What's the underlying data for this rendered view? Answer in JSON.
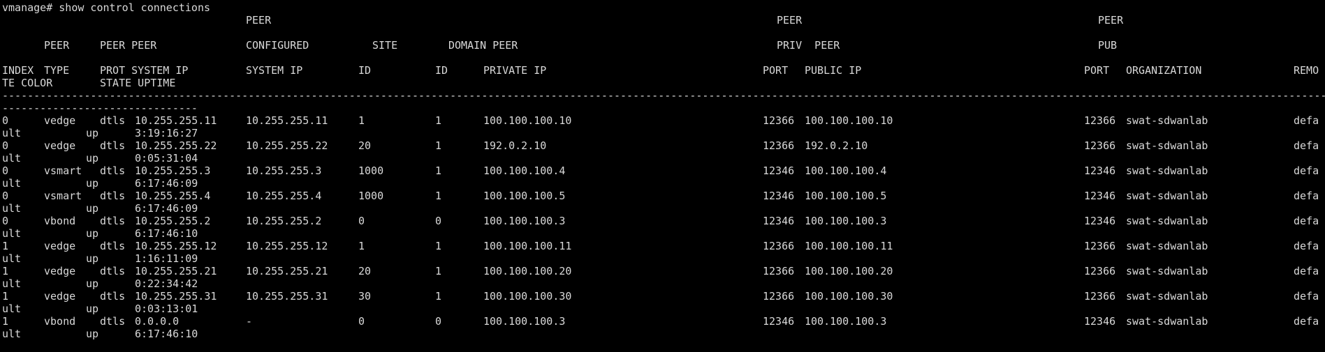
{
  "prompt": "vmanage# show control connections",
  "header": {
    "row1": {
      "peer_a": "PEER",
      "peer_b": "PEER",
      "peer_c": "PEER"
    },
    "row2": {
      "peer": "PEER",
      "peer_peer": "PEER PEER",
      "configured": "CONFIGURED",
      "site": "SITE",
      "domain_peer": "DOMAIN PEER",
      "priv_peer": "PRIV  PEER",
      "pub": "PUB"
    },
    "row3": {
      "index": "INDEX",
      "type": "TYPE",
      "prot_system_ip": "PROT SYSTEM IP",
      "system_ip": "SYSTEM IP",
      "id_site": "ID",
      "id_domain": "ID",
      "private_ip": "PRIVATE IP",
      "port_priv": "PORT",
      "public_ip": "PUBLIC IP",
      "port_pub": "PORT",
      "organization": "ORGANIZATION",
      "remo": "REMO"
    },
    "row4": {
      "te_color": "TE COLOR",
      "state_uptime": "STATE UPTIME"
    }
  },
  "separator_line1": "-----------------------------------------------------------------------------------------------------------------------------------------------------------------------------------------------------------------------------",
  "separator_line2": "-------------------------------",
  "rows": [
    {
      "index": "0",
      "type": "vedge",
      "prot": "dtls",
      "peer_system_ip": "10.255.255.11",
      "configured_system_ip": "10.255.255.11",
      "site_id": "1",
      "domain_id": "1",
      "private_ip": "100.100.100.10",
      "priv_port": "12366",
      "public_ip": "100.100.100.10",
      "pub_port": "12366",
      "organization": "swat-sdwanlab",
      "color_start": "defa",
      "color_end": "ult",
      "state": "up",
      "uptime": "3:19:16:27"
    },
    {
      "index": "0",
      "type": "vedge",
      "prot": "dtls",
      "peer_system_ip": "10.255.255.22",
      "configured_system_ip": "10.255.255.22",
      "site_id": "20",
      "domain_id": "1",
      "private_ip": "192.0.2.10",
      "priv_port": "12366",
      "public_ip": "192.0.2.10",
      "pub_port": "12366",
      "organization": "swat-sdwanlab",
      "color_start": "defa",
      "color_end": "ult",
      "state": "up",
      "uptime": "0:05:31:04"
    },
    {
      "index": "0",
      "type": "vsmart",
      "prot": "dtls",
      "peer_system_ip": "10.255.255.3",
      "configured_system_ip": "10.255.255.3",
      "site_id": "1000",
      "domain_id": "1",
      "private_ip": "100.100.100.4",
      "priv_port": "12346",
      "public_ip": "100.100.100.4",
      "pub_port": "12346",
      "organization": "swat-sdwanlab",
      "color_start": "defa",
      "color_end": "ult",
      "state": "up",
      "uptime": "6:17:46:09"
    },
    {
      "index": "0",
      "type": "vsmart",
      "prot": "dtls",
      "peer_system_ip": "10.255.255.4",
      "configured_system_ip": "10.255.255.4",
      "site_id": "1000",
      "domain_id": "1",
      "private_ip": "100.100.100.5",
      "priv_port": "12346",
      "public_ip": "100.100.100.5",
      "pub_port": "12346",
      "organization": "swat-sdwanlab",
      "color_start": "defa",
      "color_end": "ult",
      "state": "up",
      "uptime": "6:17:46:09"
    },
    {
      "index": "0",
      "type": "vbond",
      "prot": "dtls",
      "peer_system_ip": "10.255.255.2",
      "configured_system_ip": "10.255.255.2",
      "site_id": "0",
      "domain_id": "0",
      "private_ip": "100.100.100.3",
      "priv_port": "12346",
      "public_ip": "100.100.100.3",
      "pub_port": "12346",
      "organization": "swat-sdwanlab",
      "color_start": "defa",
      "color_end": "ult",
      "state": "up",
      "uptime": "6:17:46:10"
    },
    {
      "index": "1",
      "type": "vedge",
      "prot": "dtls",
      "peer_system_ip": "10.255.255.12",
      "configured_system_ip": "10.255.255.12",
      "site_id": "1",
      "domain_id": "1",
      "private_ip": "100.100.100.11",
      "priv_port": "12366",
      "public_ip": "100.100.100.11",
      "pub_port": "12366",
      "organization": "swat-sdwanlab",
      "color_start": "defa",
      "color_end": "ult",
      "state": "up",
      "uptime": "1:16:11:09"
    },
    {
      "index": "1",
      "type": "vedge",
      "prot": "dtls",
      "peer_system_ip": "10.255.255.21",
      "configured_system_ip": "10.255.255.21",
      "site_id": "20",
      "domain_id": "1",
      "private_ip": "100.100.100.20",
      "priv_port": "12366",
      "public_ip": "100.100.100.20",
      "pub_port": "12366",
      "organization": "swat-sdwanlab",
      "color_start": "defa",
      "color_end": "ult",
      "state": "up",
      "uptime": "0:22:34:42"
    },
    {
      "index": "1",
      "type": "vedge",
      "prot": "dtls",
      "peer_system_ip": "10.255.255.31",
      "configured_system_ip": "10.255.255.31",
      "site_id": "30",
      "domain_id": "1",
      "private_ip": "100.100.100.30",
      "priv_port": "12366",
      "public_ip": "100.100.100.30",
      "pub_port": "12366",
      "organization": "swat-sdwanlab",
      "color_start": "defa",
      "color_end": "ult",
      "state": "up",
      "uptime": "0:03:13:01"
    },
    {
      "index": "1",
      "type": "vbond",
      "prot": "dtls",
      "peer_system_ip": "0.0.0.0",
      "configured_system_ip": "-",
      "site_id": "0",
      "domain_id": "0",
      "private_ip": "100.100.100.3",
      "priv_port": "12346",
      "public_ip": "100.100.100.3",
      "pub_port": "12346",
      "organization": "swat-sdwanlab",
      "color_start": "defa",
      "color_end": "ult",
      "state": "up",
      "uptime": "6:17:46:10"
    }
  ],
  "colors": {
    "background": "#000000",
    "foreground": "#d9d9d9"
  }
}
